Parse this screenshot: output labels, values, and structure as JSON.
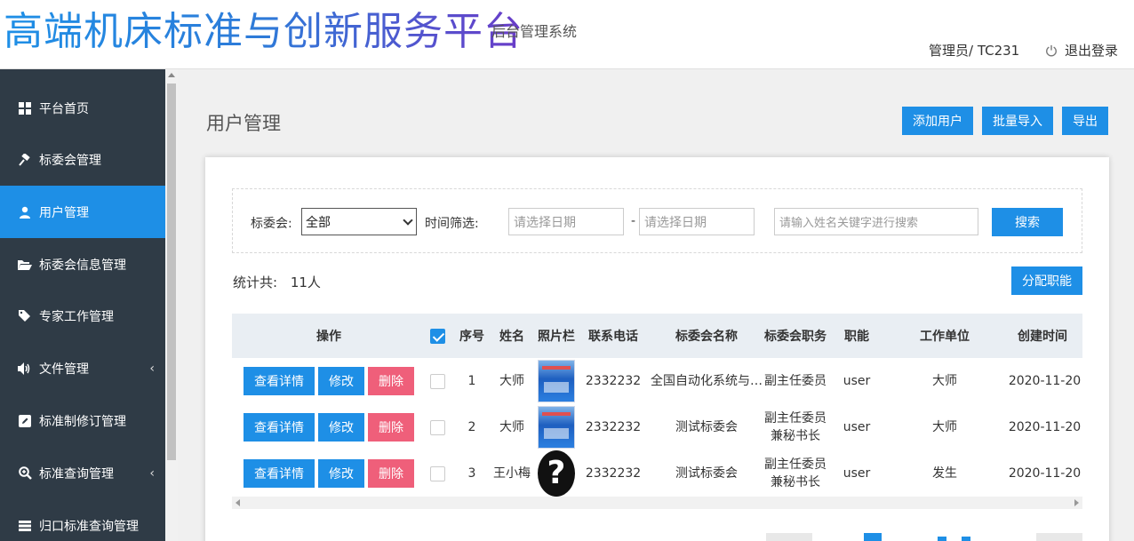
{
  "header": {
    "title": "高端机床标准与创新服务平台",
    "subtitle": "后台管理系统",
    "user": "管理员/ TC231",
    "logout": "退出登录"
  },
  "sidebar": {
    "items": [
      {
        "label": "平台首页",
        "icon": "grid-icon"
      },
      {
        "label": "标委会管理",
        "icon": "gavel-icon"
      },
      {
        "label": "用户管理",
        "icon": "user-icon",
        "active": true
      },
      {
        "label": "标委会信息管理",
        "icon": "folder-open-icon"
      },
      {
        "label": "专家工作管理",
        "icon": "tags-icon"
      },
      {
        "label": "文件管理",
        "icon": "volume-icon",
        "chevron": "‹"
      },
      {
        "label": "标准制修订管理",
        "icon": "edit-icon"
      },
      {
        "label": "标准查询管理",
        "icon": "search-plus-icon",
        "chevron": "‹"
      },
      {
        "label": "归口标准查询管理",
        "icon": "list-icon"
      }
    ]
  },
  "page": {
    "title": "用户管理",
    "actions": {
      "add": "添加用户",
      "import": "批量导入",
      "export": "导出"
    }
  },
  "filter": {
    "committee_label": "标委会:",
    "committee_value": "全部",
    "time_label": "时间筛选:",
    "date_start_placeholder": "请选择日期",
    "date_sep": "-",
    "date_end_placeholder": "请选择日期",
    "keyword_placeholder": "请输入姓名关键字进行搜索",
    "search_button": "搜索"
  },
  "stats": {
    "label": "统计共:",
    "count": "11人",
    "assign_button": "分配职能"
  },
  "table": {
    "headers": {
      "ops": "操作",
      "seq": "序号",
      "name": "姓名",
      "photo": "照片栏",
      "phone": "联系电话",
      "committee": "标委会名称",
      "position": "标委会职务",
      "role": "职能",
      "company": "工作单位",
      "created": "创建时间"
    },
    "row_buttons": {
      "view": "查看详情",
      "edit": "修改",
      "delete": "删除"
    },
    "rows": [
      {
        "seq": "1",
        "name": "大师",
        "photo": "screenshot",
        "phone": "2332232",
        "committee": "全国自动化系统与…",
        "position": "副主任委员",
        "role": "user",
        "company": "大师",
        "created": "2020-11-20"
      },
      {
        "seq": "2",
        "name": "大师",
        "photo": "screenshot",
        "phone": "2332232",
        "committee": "测试标委会",
        "position": "副主任委员兼秘书长",
        "role": "user",
        "company": "大师",
        "created": "2020-11-20"
      },
      {
        "seq": "3",
        "name": "王小梅",
        "photo": "question-mark",
        "phone": "2332232",
        "committee": "测试标委会",
        "position": "副主任委员兼秘书长",
        "role": "user",
        "company": "发生",
        "created": "2020-11-20"
      }
    ]
  },
  "colors": {
    "accent": "#1e8fe6",
    "danger": "#ef5f7a",
    "sidebar_bg": "#2f3b46"
  }
}
